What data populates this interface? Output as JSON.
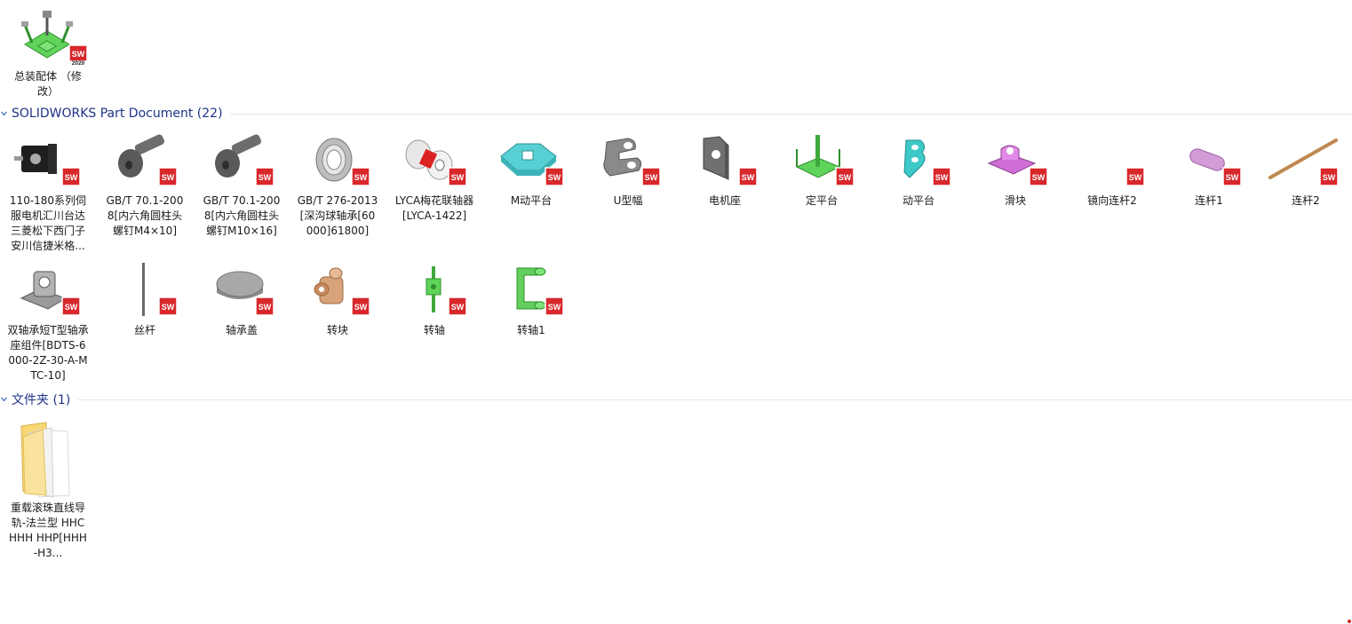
{
  "top_item": {
    "label": "总装配体 （修改）",
    "badge_version": "2020"
  },
  "groups": [
    {
      "title": "SOLIDWORKS Part Document (22)"
    },
    {
      "title": "文件夹 (1)"
    }
  ],
  "parts_row1": [
    "110-180系列伺服电机汇川台达三菱松下西门子安川信捷米格...",
    "GB∕T 70.1-2008[内六角圆柱头螺钉M4×10]",
    "GB∕T 70.1-2008[内六角圆柱头螺钉M10×16]",
    "GB∕T 276-2013[深沟球轴承[60000]61800]",
    "LYCA梅花联轴器[LYCA-1422]",
    "M动平台",
    "U型幅",
    "电机座",
    "定平台",
    "动平台",
    "滑块",
    "镜向连杆2",
    "连杆1",
    "连杆2"
  ],
  "parts_row2": [
    "双轴承短T型轴承座组件[BDTS-6000-2Z-30-A-MTC-10]",
    "丝杆",
    "轴承盖",
    "转块",
    "转轴",
    "转轴1"
  ],
  "folder_item": {
    "label": "重载滚珠直线导轨-法兰型 HHC HHH HHP[HHH-H3..."
  },
  "badge_text": "SW",
  "colors": {
    "group_title": "#1e3287",
    "badge_red": "#d8282c"
  }
}
